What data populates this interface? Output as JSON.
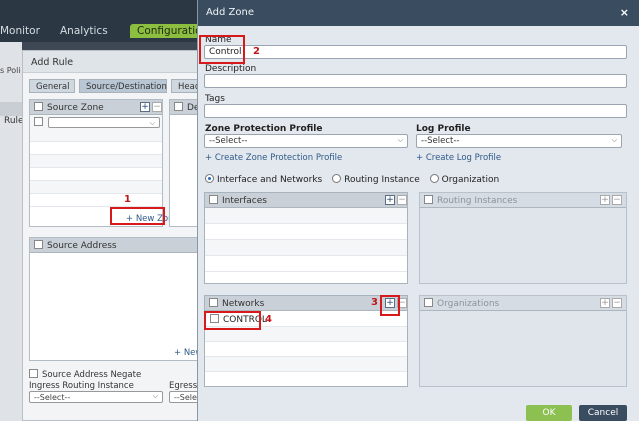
{
  "topnav": {
    "monitor": "Monitor",
    "analytics": "Analytics",
    "configuration": "Configuration"
  },
  "bg_left": {
    "fragment1": "s Poli",
    "fragment2": "Rule"
  },
  "add_rule": {
    "title": "Add Rule",
    "tabs": [
      "General",
      "Source/Destination",
      "Heade"
    ],
    "source_zone": {
      "header": "Source Zone",
      "new_zone_link": "+ New Zone"
    },
    "dest_fragment": "De",
    "source_address": {
      "header": "Source Address",
      "new_link_fragment": "+ New"
    },
    "source_address_negate": "Source Address Negate",
    "ingress_routing_instance": {
      "label": "Ingress Routing Instance",
      "value": "--Select--"
    },
    "egress_fragment": {
      "label": "Egress I",
      "value": "--Selec"
    }
  },
  "add_zone": {
    "title": "Add Zone",
    "close_glyph": "×",
    "name": {
      "label": "Name",
      "value": "Control"
    },
    "description": {
      "label": "Description",
      "value": ""
    },
    "tags": {
      "label": "Tags",
      "value": ""
    },
    "zone_protection_profile": {
      "label": "Zone Protection Profile",
      "value": "--Select--",
      "create_link": "+ Create Zone Protection Profile"
    },
    "log_profile": {
      "label": "Log Profile",
      "value": "--Select--",
      "create_link": "+ Create Log Profile"
    },
    "radio_options": [
      {
        "label": "Interface and Networks",
        "selected": true
      },
      {
        "label": "Routing Instance",
        "selected": false
      },
      {
        "label": "Organization",
        "selected": false
      }
    ],
    "panels": {
      "interfaces": "Interfaces",
      "routing_instances": "Routing Instances",
      "networks": {
        "header": "Networks",
        "items": [
          "CONTROL"
        ]
      },
      "organizations": "Organizations"
    },
    "buttons": {
      "ok": "OK",
      "cancel": "Cancel"
    }
  },
  "annotations": [
    "1",
    "2",
    "3",
    "4"
  ],
  "colors": {
    "topbar": "#2b3742",
    "config_tab": "#8cbf3f",
    "zone_header": "#3a4c60",
    "ok_button": "#8cc152",
    "cancel_button": "#3a4c60",
    "link": "#2e5a88",
    "annotation_red": "#d7191c"
  },
  "icons": {
    "add": "plus-icon",
    "remove": "minus-icon",
    "dropdown": "chevron-down-icon",
    "close": "close-icon"
  }
}
